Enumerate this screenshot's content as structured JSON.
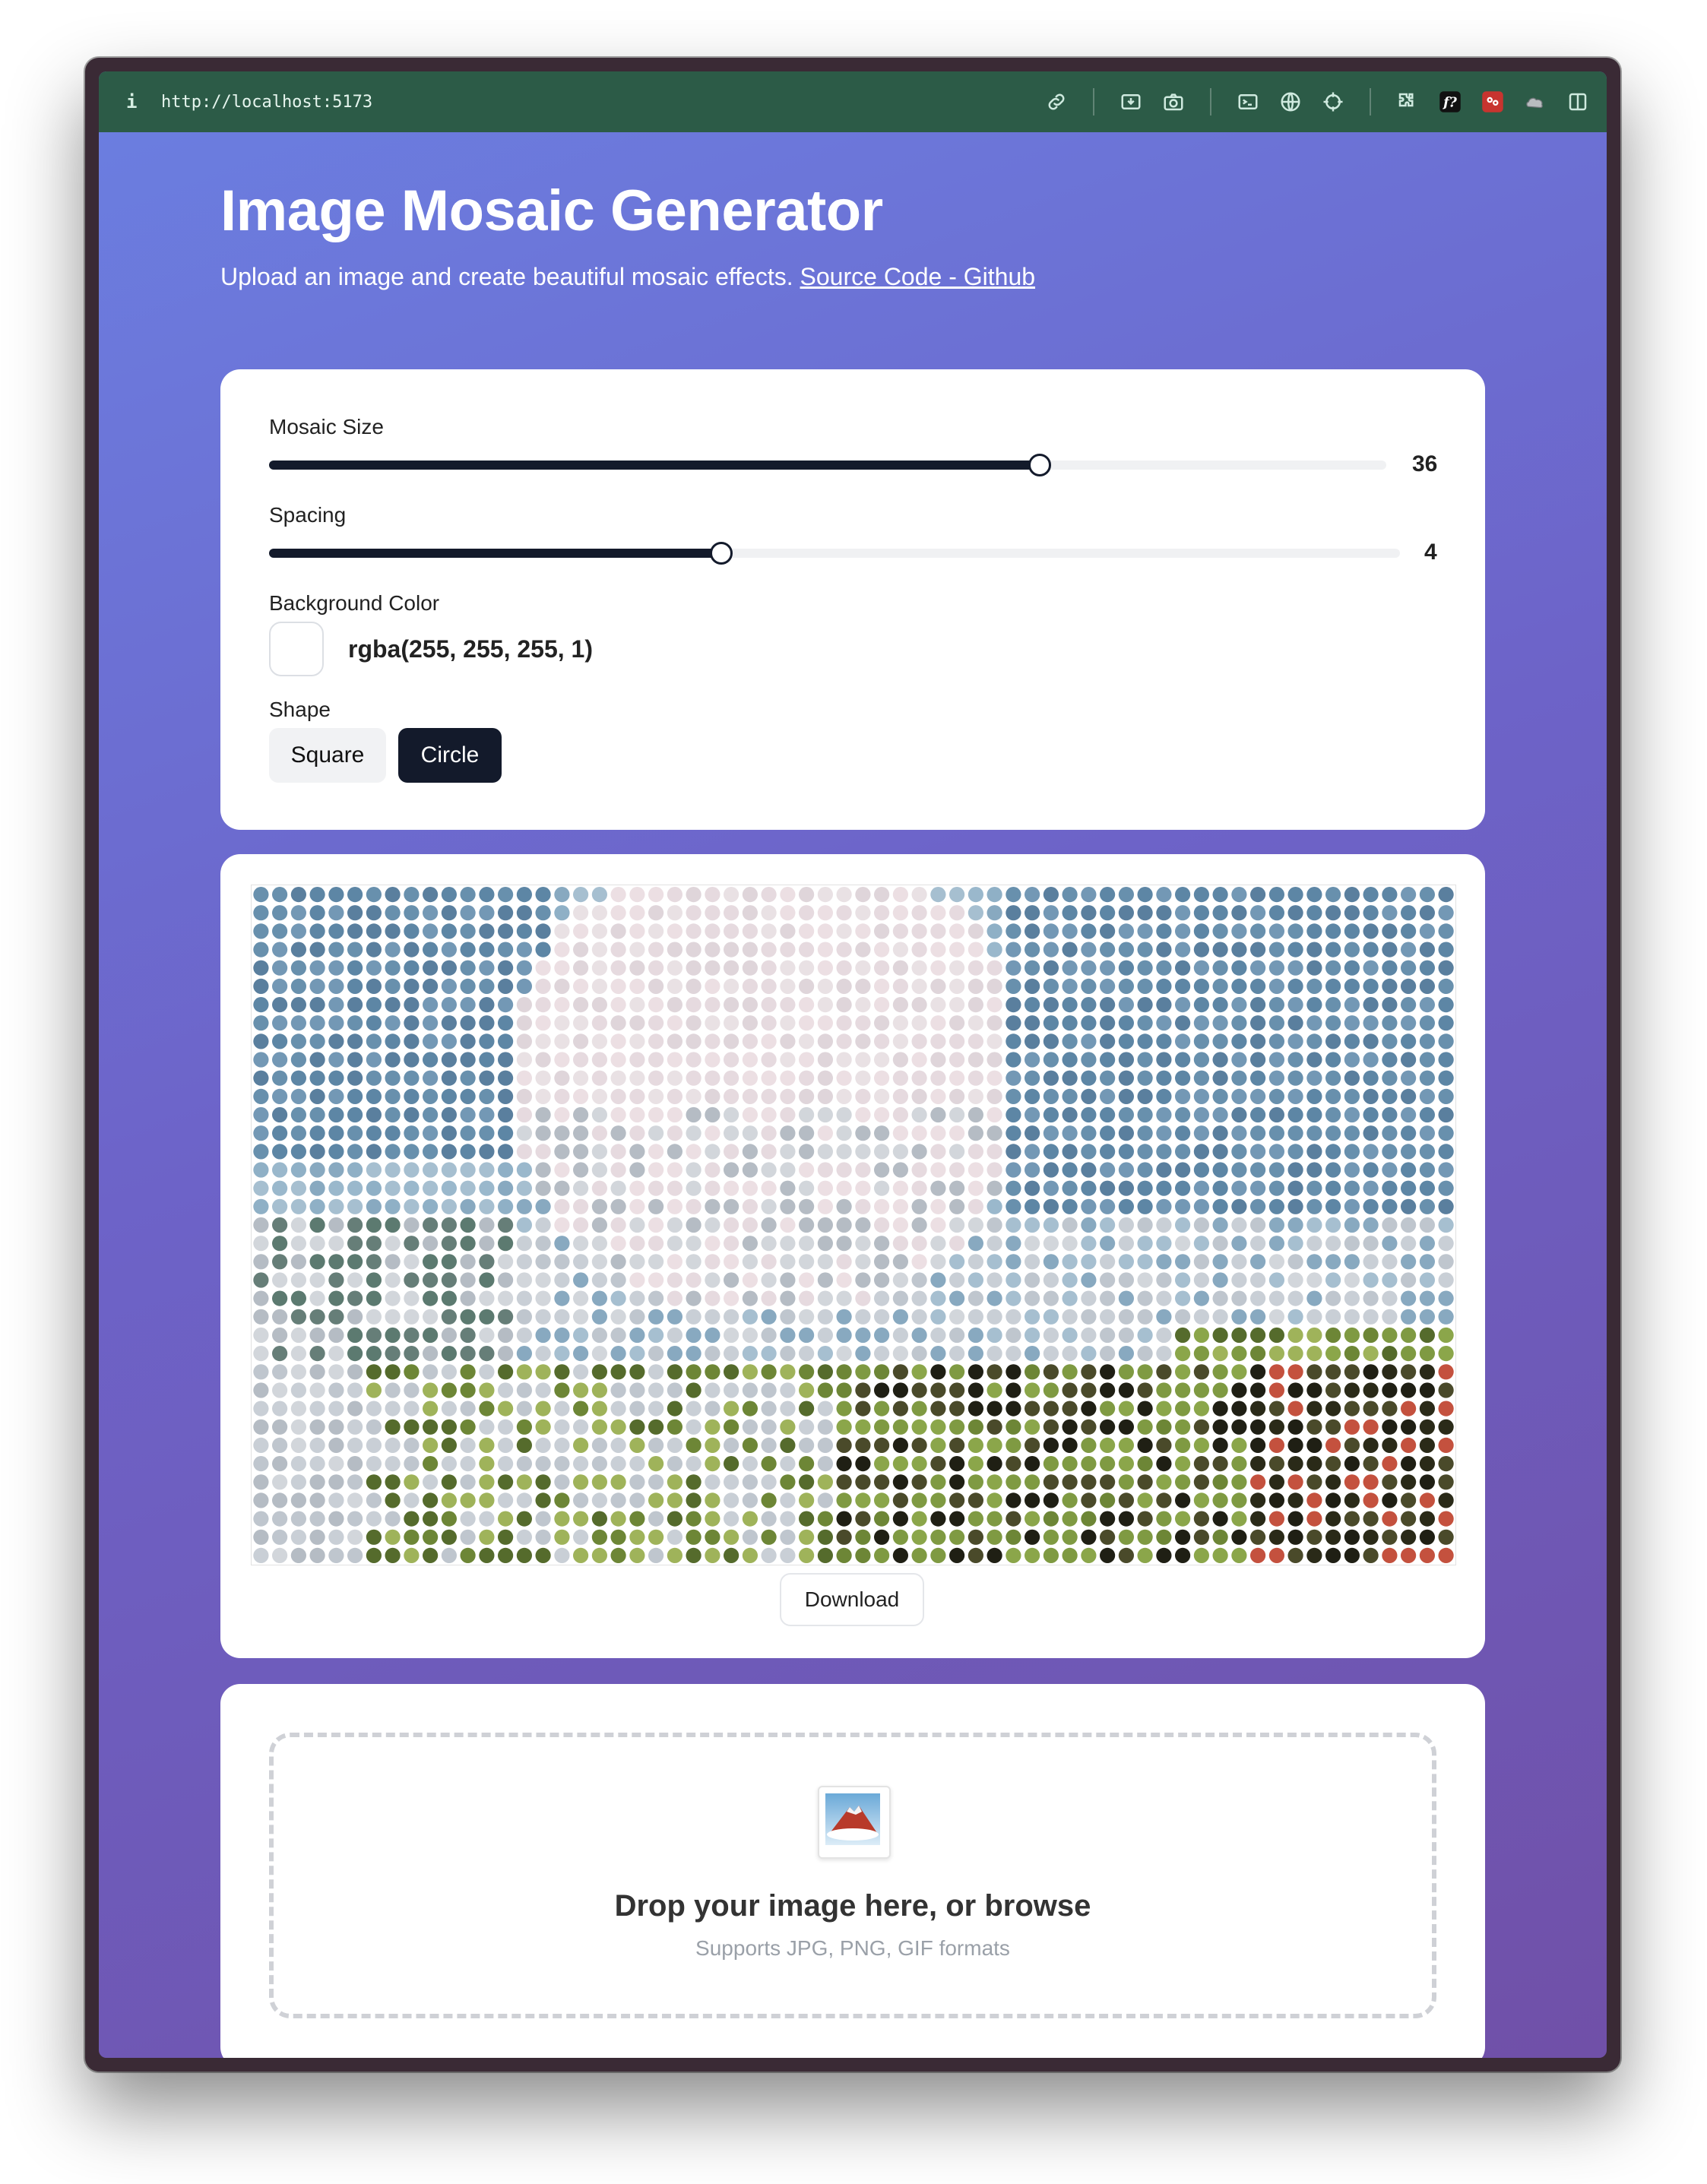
{
  "browser": {
    "url": "http://localhost:5173",
    "info_glyph": "i",
    "toolbar_icons": [
      "link-icon",
      "download-screenshot-icon",
      "camera-icon",
      "terminal-icon",
      "globe-icon",
      "crosshair-icon",
      "puzzle-icon",
      "function-icon",
      "extension-icon",
      "cloud-icon",
      "sidebar-icon"
    ]
  },
  "page": {
    "title": "Image Mosaic Generator",
    "subtitle": "Upload an image and create beautiful mosaic effects.",
    "source_link": "Source Code - Github"
  },
  "controls": {
    "mosaic_size": {
      "label": "Mosaic Size",
      "value": "36",
      "fraction": 0.69
    },
    "spacing": {
      "label": "Spacing",
      "value": "4",
      "fraction": 0.4
    },
    "background_color": {
      "label": "Background Color",
      "value": "rgba(255, 255, 255, 1)",
      "swatch": "#ffffff"
    },
    "shape": {
      "label": "Shape",
      "options": [
        "Square",
        "Circle"
      ],
      "selected": "Circle"
    }
  },
  "preview": {
    "download_label": "Download",
    "shape": "circle",
    "grid": {
      "columns": 64,
      "rows": 37
    }
  },
  "upload": {
    "title": "Drop your image here, or browse",
    "subtitle": "Supports JPG, PNG, GIF formats"
  },
  "colors": {
    "primary": "#131a2b",
    "toolbar": "#2c5b47",
    "gradient_start": "#6b7fe1",
    "gradient_end": "#7050a8"
  }
}
